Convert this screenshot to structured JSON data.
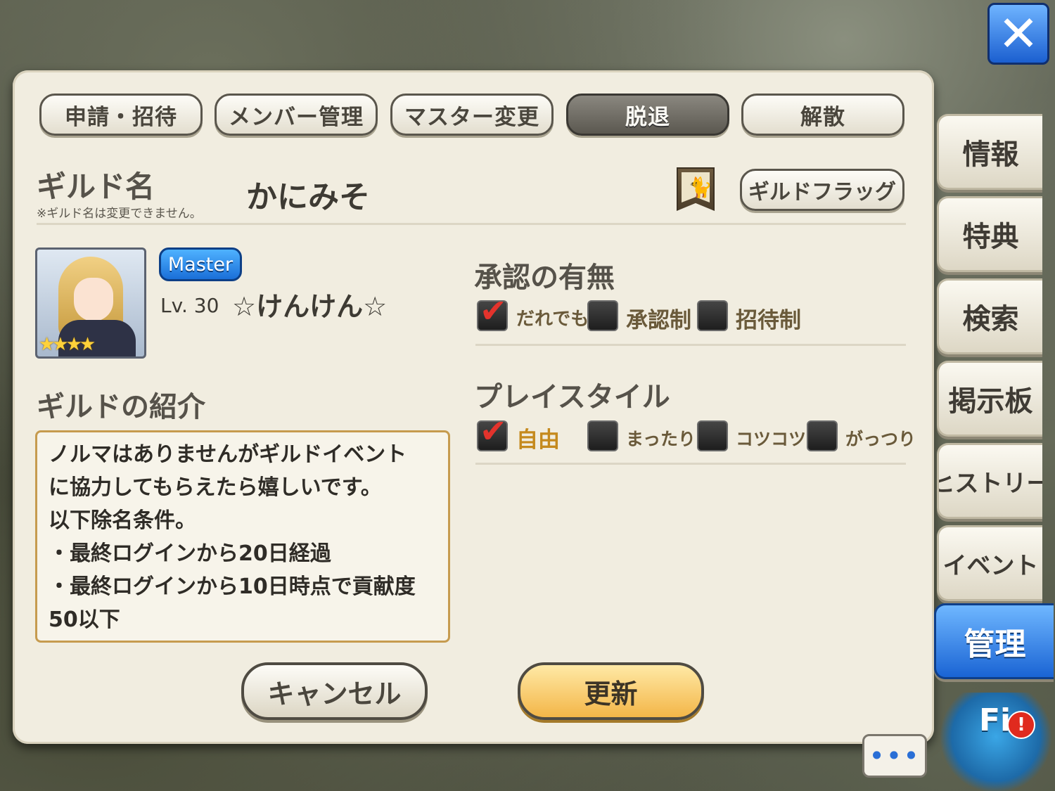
{
  "close_button": {
    "label": "✕"
  },
  "tabs": [
    {
      "label": "申請・招待",
      "active": false
    },
    {
      "label": "メンバー管理",
      "active": false
    },
    {
      "label": "マスター変更",
      "active": false
    },
    {
      "label": "脱退",
      "active": true
    },
    {
      "label": "解散",
      "active": false
    }
  ],
  "guild": {
    "name_label": "ギルド名",
    "name_note": "※ギルド名は変更できません。",
    "name": "かにみそ",
    "flag_button": "ギルドフラッグ"
  },
  "member": {
    "badge": "Master",
    "level": "Lv. 30",
    "name": "☆けんけん☆",
    "stars": "★★★★"
  },
  "approval": {
    "title": "承認の有無",
    "options": [
      {
        "label": "だれでも",
        "checked": true
      },
      {
        "label": "承認制",
        "checked": false
      },
      {
        "label": "招待制",
        "checked": false
      }
    ]
  },
  "playstyle": {
    "title": "プレイスタイル",
    "options": [
      {
        "label": "自由",
        "checked": true
      },
      {
        "label": "まったり",
        "checked": false
      },
      {
        "label": "コツコツ",
        "checked": false
      },
      {
        "label": "がっつり",
        "checked": false
      }
    ]
  },
  "intro": {
    "title": "ギルドの紹介",
    "lines": [
      "ノルマはありませんがギルドイベント",
      "に協力してもらえたら嬉しいです。",
      "以下除名条件。",
      "・最終ログインから20日経過",
      "・最終ログインから10日時点で貢献度",
      "50以下"
    ]
  },
  "buttons": {
    "cancel": "キャンセル",
    "update": "更新"
  },
  "side_tabs": [
    {
      "label": "情報",
      "active": false
    },
    {
      "label": "特典",
      "active": false
    },
    {
      "label": "検索",
      "active": false
    },
    {
      "label": "掲示板",
      "active": false
    },
    {
      "label": "ヒストリー",
      "active": false
    },
    {
      "label": "イベント",
      "active": false
    },
    {
      "label": "管理",
      "active": true
    }
  ],
  "chat_button": {
    "label": "•••"
  },
  "field_button": {
    "label": "Fi",
    "alert": "!"
  },
  "colors": {
    "accent_blue": "#1a64d4",
    "update_gold": "#f3b648",
    "check_red": "#e3332c"
  }
}
